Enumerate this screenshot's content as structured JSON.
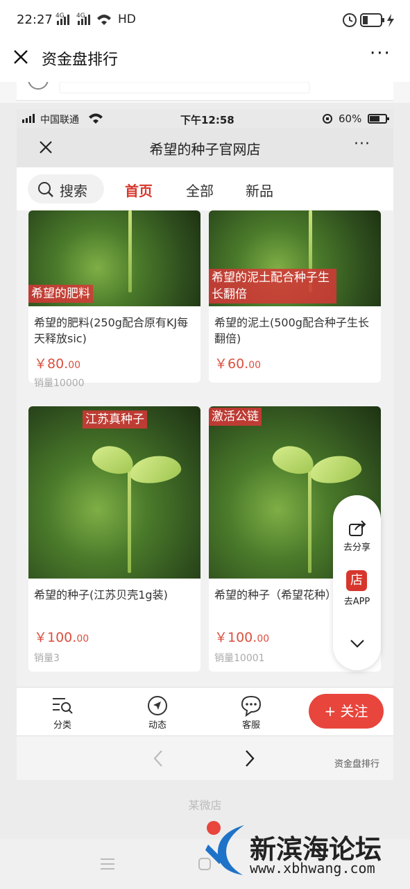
{
  "outer_status": {
    "time": "22:27",
    "signal_a": "4G",
    "signal_b": "4G",
    "hd": "HD"
  },
  "outer_nav": {
    "title": "资金盘排行",
    "more": "···"
  },
  "inner_status": {
    "carrier": "中国联通",
    "time": "下午12:58",
    "battery": "60%"
  },
  "inner_nav": {
    "title": "希望的种子官网店",
    "more": "···"
  },
  "tabs": {
    "search": "搜索",
    "home": "首页",
    "all": "全部",
    "new": "新品"
  },
  "products": [
    {
      "tag": "希望的肥料",
      "name": "希望的肥料(250g配合原有KJ每天释放sic)",
      "price_int": "￥80.",
      "price_dec": "00",
      "sold": "销量10000"
    },
    {
      "tag": "希望的泥土配合种子生长翻倍",
      "name": "希望的泥土(500g配合种子生长翻倍)",
      "price_int": "￥60.",
      "price_dec": "00",
      "sold": ""
    },
    {
      "tag": "江苏真种子",
      "name": "希望的种子(江苏贝壳1g装)",
      "price_int": "￥100.",
      "price_dec": "00",
      "sold": "销量3"
    },
    {
      "tag": "激活公链",
      "name": "希望的种子（希望花种）",
      "price_int": "￥100.",
      "price_dec": "00",
      "sold": "销量10001"
    }
  ],
  "float": {
    "share": "去分享",
    "app_icon": "店",
    "app": "去APP"
  },
  "bottom": {
    "category": "分类",
    "dynamic": "动态",
    "service": "客服",
    "follow": "+ 关注"
  },
  "browser": {
    "watermark": "资金盘排行"
  },
  "footer": {
    "text": "某微店"
  },
  "watermark": {
    "title": "新滨海论坛",
    "url": "www.xbhwang.com"
  },
  "colors": {
    "accent": "#e8453c",
    "tab_active": "#d7362c"
  }
}
